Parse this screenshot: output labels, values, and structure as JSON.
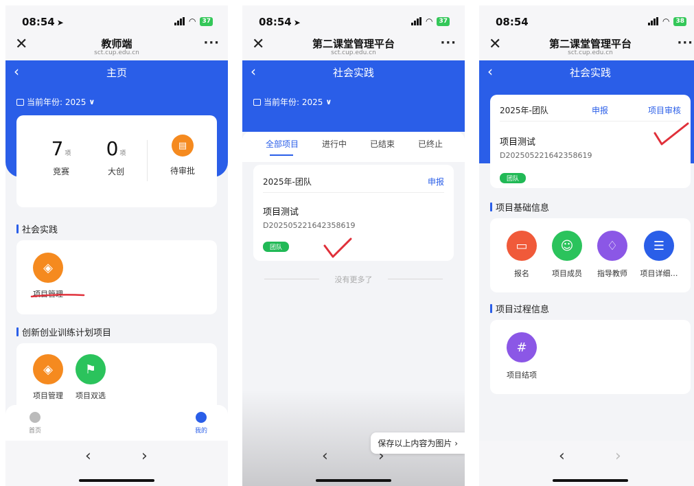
{
  "common": {
    "back_glyph": "‹",
    "close_glyph": "✕",
    "more_glyph": "···",
    "nav_domain": "sct.cup.edu.cn",
    "year_label": "当前年份: 2025",
    "team_year": "2025年-团队",
    "report_link": "申报",
    "project_name": "项目测试",
    "project_code": "D202505221642358619",
    "team_tag": "团队",
    "prev_glyph": "‹",
    "next_glyph": "›"
  },
  "phone1": {
    "status_time": "08:54",
    "battery": "37",
    "app_title": "教师端",
    "page_title": "主页",
    "stats": [
      {
        "num": "7",
        "unit": "项",
        "label": "竞赛"
      },
      {
        "num": "0",
        "unit": "项",
        "label": "大创"
      }
    ],
    "pending_label": "待审批",
    "section1": "社会实践",
    "project_mgmt": "项目管理",
    "section2": "创新创业训练计划项目",
    "project_mgmt2": "项目管理",
    "project_select": "项目双选",
    "tab_home": "首页",
    "tab_mine": "我的"
  },
  "phone2": {
    "status_time": "08:54",
    "battery": "37",
    "app_title": "第二课堂管理平台",
    "page_title": "社会实践",
    "tabs": [
      "全部项目",
      "进行中",
      "已结束",
      "已终止"
    ],
    "no_more": "没有更多了",
    "save_image": "保存以上内容为图片 ›"
  },
  "phone3": {
    "status_time": "08:54",
    "battery": "38",
    "app_title": "第二课堂管理平台",
    "page_title": "社会实践",
    "project_review": "项目审核",
    "basic_section": "项目基础信息",
    "basic_items": [
      "报名",
      "项目成员",
      "指导教师",
      "项目详细…"
    ],
    "process_section": "项目过程信息",
    "process_item": "项目结项"
  },
  "colors": {
    "primary_blue": "#2a5ee8",
    "orange": "#f58a1f",
    "green": "#2bc35c",
    "annotation_red": "#e0303a"
  }
}
